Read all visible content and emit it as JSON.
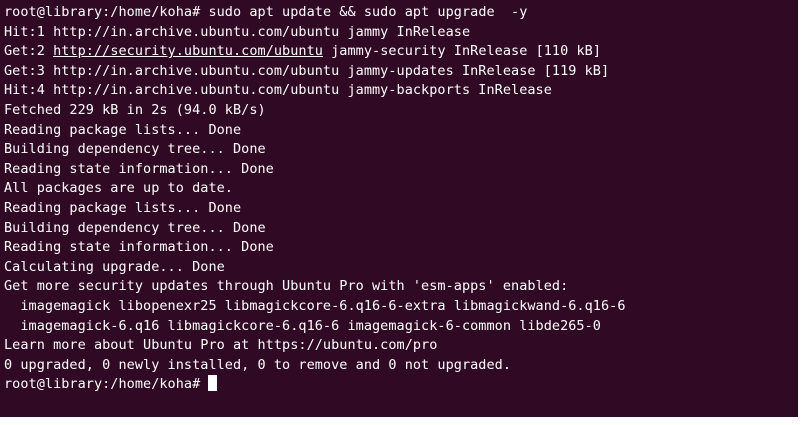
{
  "terminal": {
    "prompt": "root@library:/home/koha# ",
    "command": "sudo apt update && sudo apt upgrade  -y",
    "output": [
      "Hit:1 http://in.archive.ubuntu.com/ubuntu jammy InRelease",
      "Get:2 ",
      "Get:3 http://in.archive.ubuntu.com/ubuntu jammy-updates InRelease [119 kB]",
      "Hit:4 http://in.archive.ubuntu.com/ubuntu jammy-backports InRelease",
      "Fetched 229 kB in 2s (94.0 kB/s)",
      "Reading package lists... Done",
      "Building dependency tree... Done",
      "Reading state information... Done",
      "All packages are up to date.",
      "Reading package lists... Done",
      "Building dependency tree... Done",
      "Reading state information... Done",
      "Calculating upgrade... Done",
      "Get more security updates through Ubuntu Pro with 'esm-apps' enabled:",
      "  imagemagick libopenexr25 libmagickcore-6.q16-6-extra libmagickwand-6.q16-6",
      "  imagemagick-6.q16 libmagickcore-6.q16-6 imagemagick-6-common libde265-0",
      "Learn more about Ubuntu Pro at https://ubuntu.com/pro",
      "0 upgraded, 0 newly installed, 0 to remove and 0 not upgraded."
    ],
    "line2_link": "http://security.ubuntu.com/ubuntu",
    "line2_rest": " jammy-security InRelease [110 kB]",
    "final_prompt": "root@library:/home/koha# "
  },
  "colors": {
    "background": "#300a24",
    "foreground": "#ffffff"
  }
}
